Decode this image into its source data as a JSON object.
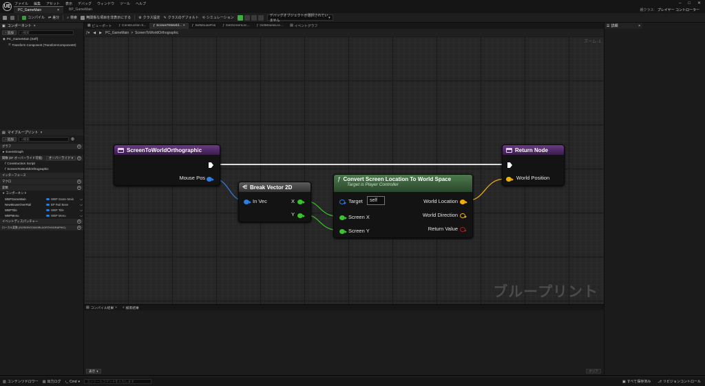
{
  "app": {
    "logo": "UE",
    "menu": [
      "ファイル",
      "編集",
      "アセット",
      "表示",
      "デバッグ",
      "ウィンドウ",
      "ツール",
      "ヘルプ"
    ],
    "doc_tabs": [
      {
        "label": "PC_GameMain",
        "active": true
      },
      {
        "label": "BP_GameMain",
        "active": false
      }
    ],
    "project_label": "親クラス:",
    "project_value": "プレイヤー コントローラー"
  },
  "toolbar": {
    "compile": "コンパイル",
    "diff": "差分",
    "find": "検索",
    "hide_unrelated": "無関係な項目を非表示にする",
    "class_settings": "クラス設定",
    "class_defaults": "クラスのデフォルト",
    "simulation": "シミュレーション",
    "debug_object": "デバッグオブジェクトが選択されていません"
  },
  "components": {
    "tab": "コンポーネント",
    "add": "追加",
    "search_placeholder": "検索",
    "items": [
      "PC_GameMain (Self)",
      "Transform Component (TransformComponent0)"
    ]
  },
  "my_blueprint": {
    "tab": "マイブループリント",
    "add": "追加",
    "search_placeholder": "検索",
    "graphs_header": "グラフ",
    "event_graph": "EventGraph",
    "functions_header": "関数 (87 オーバーライド可能)",
    "override_label": "オーバーライド",
    "functions": [
      "Construction Script",
      "ScreenToWorldOrthographic"
    ],
    "interfaces_header": "インターフェース",
    "macros_header": "マクロ",
    "variables_header": "変数",
    "components_subheader": "コンポーネント",
    "variables": [
      {
        "name": "WBPGameMain",
        "type": "WBP Game Main"
      },
      {
        "name": "NewMouseOverRail",
        "type": "BP Rail Base"
      },
      {
        "name": "WBPTitle",
        "type": "WBP Title"
      },
      {
        "name": "WBPMenu",
        "type": "WBP Menu"
      }
    ],
    "dispatchers_header": "イベントディスパッチャー",
    "locals_header": "ローカル変数 (SCREENTOWORLDORTHOGRAPHIC)"
  },
  "editor_tabs": [
    {
      "label": "ビューポート",
      "active": false
    },
    {
      "label": "Construction S...",
      "active": false
    },
    {
      "label": "ScreenToWorld...",
      "active": true
    },
    {
      "label": "SetMousePos",
      "active": false
    },
    {
      "label": "GetScreenLoc...",
      "active": false
    },
    {
      "label": "GetMouseLoc...",
      "active": false
    },
    {
      "label": "イベントグラフ",
      "active": false
    }
  ],
  "breadcrumb": {
    "root": "PC_GameMain",
    "sep": ">",
    "current": "ScreenToWorldOrthographic"
  },
  "graph": {
    "zoom": "ズーム -1",
    "watermark": "ブループリント",
    "nodes": {
      "entry": {
        "title": "ScreenToWorldOrthographic",
        "pins": [
          "Mouse Pos"
        ]
      },
      "break": {
        "title": "Break Vector 2D",
        "pins_in": [
          "In Vec"
        ],
        "pins_out": [
          "X",
          "Y"
        ]
      },
      "convert": {
        "title": "Convert Screen Location To World Space",
        "subtitle": "Target is Player Controller",
        "pins_in": [
          "Target",
          "Screen X",
          "Screen Y"
        ],
        "target_value": "self",
        "pins_out": [
          "World Location",
          "World Direction",
          "Return Value"
        ]
      },
      "return": {
        "title": "Return Node",
        "pins": [
          "World Position"
        ]
      }
    }
  },
  "compiler": {
    "tabs": [
      "コンパイル結果",
      "検索結果"
    ],
    "show": "表示",
    "clear": "クリア"
  },
  "details": {
    "tab": "詳細"
  },
  "statusbar": {
    "content_drawer": "コンテンツドロワー",
    "output_log": "出力ログ",
    "cmd": "Cmd",
    "cmd_placeholder": "コンソールコマンドを入力します",
    "save_all": "すべて保存済み",
    "revision": "リビジョンコントロール"
  },
  "colors": {
    "function_header": "#6b3a86",
    "pure_node_header": "#4c7a4d",
    "exec_wire": "#ffffff",
    "vector2d_pin": "#2f7de1",
    "float_pin": "#39c42d",
    "vector_pin": "#f1b10a",
    "bool_pin": "#b21b1b",
    "accent": "#2d72b8"
  },
  "icons": [
    "unreal-logo-icon",
    "save-icon",
    "browse-icon",
    "compile-icon",
    "diff-icon",
    "search-icon",
    "play-icon",
    "function-icon",
    "node-icon"
  ]
}
